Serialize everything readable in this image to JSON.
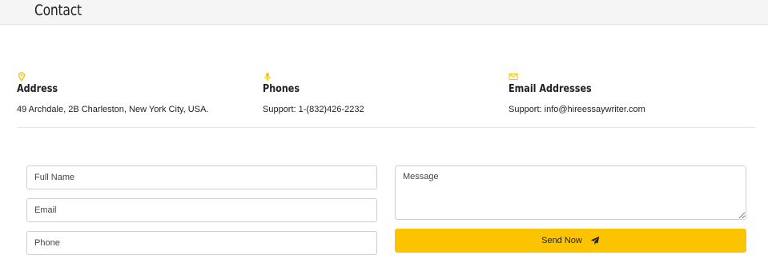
{
  "header": {
    "title": "Contact"
  },
  "info": {
    "address": {
      "icon": "map-pin-icon",
      "heading": "Address",
      "value": "49 Archdale, 2B Charleston, New York City, USA."
    },
    "phones": {
      "icon": "microphone-icon",
      "heading": "Phones",
      "value": "Support: 1-(832)426-2232"
    },
    "email": {
      "icon": "envelope-icon",
      "heading": "Email Addresses",
      "value": "Support: info@hireessaywriter.com"
    }
  },
  "form": {
    "full_name": {
      "placeholder": "Full Name",
      "value": ""
    },
    "email": {
      "placeholder": "Email",
      "value": ""
    },
    "phone": {
      "placeholder": "Phone",
      "value": ""
    },
    "message": {
      "placeholder": "Message",
      "value": ""
    },
    "submit_label": "Send Now",
    "submit_icon": "paper-plane-icon"
  },
  "colors": {
    "accent": "#fcc400",
    "header_bg": "#f5f5f5"
  }
}
